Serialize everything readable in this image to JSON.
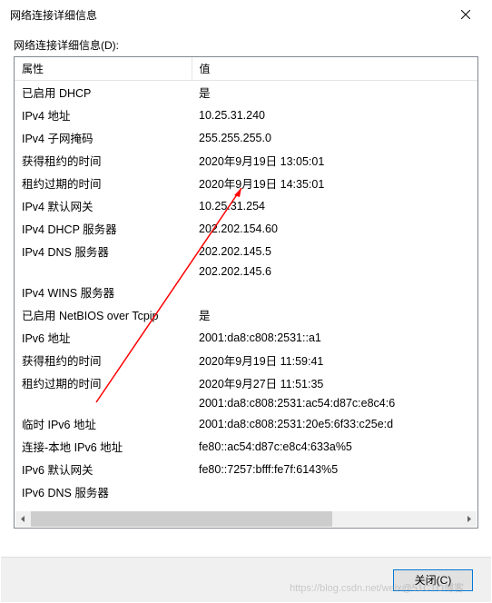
{
  "window": {
    "title": "网络连接详细信息",
    "label": "网络连接详细信息(D):",
    "close_button_label": "关闭(C)"
  },
  "columns": {
    "property": "属性",
    "value": "值"
  },
  "rows": [
    {
      "prop": "已启用 DHCP",
      "val": "是"
    },
    {
      "prop": "IPv4 地址",
      "val": "10.25.31.240"
    },
    {
      "prop": "IPv4 子网掩码",
      "val": "255.255.255.0"
    },
    {
      "prop": "获得租约的时间",
      "val": "2020年9月19日 13:05:01"
    },
    {
      "prop": "租约过期的时间",
      "val": "2020年9月19日 14:35:01"
    },
    {
      "prop": "IPv4 默认网关",
      "val": "10.25.31.254"
    },
    {
      "prop": "IPv4 DHCP 服务器",
      "val": "202.202.154.60"
    },
    {
      "prop": "IPv4 DNS 服务器",
      "val": "202.202.145.5"
    },
    {
      "prop": "",
      "val": "202.202.145.6"
    },
    {
      "prop": "IPv4 WINS 服务器",
      "val": ""
    },
    {
      "prop": "已启用 NetBIOS over Tcpip",
      "val": "是"
    },
    {
      "prop": "IPv6 地址",
      "val": "2001:da8:c808:2531::a1"
    },
    {
      "prop": "获得租约的时间",
      "val": "2020年9月19日 11:59:41"
    },
    {
      "prop": "租约过期的时间",
      "val": "2020年9月27日 11:51:35"
    },
    {
      "prop": "",
      "val": "2001:da8:c808:2531:ac54:d87c:e8c4:6"
    },
    {
      "prop": "临时 IPv6 地址",
      "val": "2001:da8:c808:2531:20e5:6f33:c25e:d"
    },
    {
      "prop": "连接-本地 IPv6 地址",
      "val": "fe80::ac54:d87c:e8c4:633a%5"
    },
    {
      "prop": "IPv6 默认网关",
      "val": "fe80::7257:bfff:fe7f:6143%5"
    },
    {
      "prop": "IPv6 DNS 服务器",
      "val": ""
    }
  ],
  "annotation": {
    "line_color": "#ff0000"
  },
  "watermark": "https://blog.csdn.net/weix@51CTO博客"
}
